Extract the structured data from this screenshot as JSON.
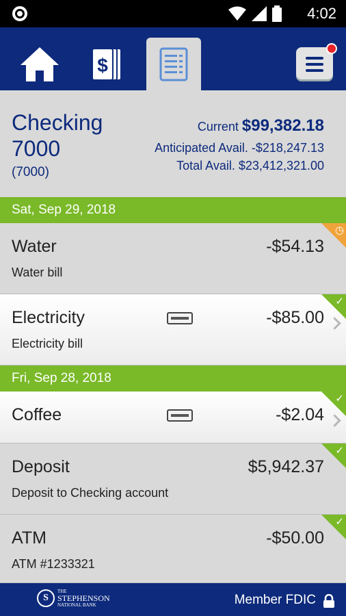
{
  "status_bar": {
    "time": "4:02"
  },
  "nav": {
    "items": [
      {
        "name": "home",
        "icon": "home-icon"
      },
      {
        "name": "payments",
        "icon": "dollar-bill-icon"
      },
      {
        "name": "transactions",
        "icon": "document-list-icon",
        "active": true
      },
      {
        "name": "menu",
        "icon": "hamburger-menu-icon",
        "has_notification": true
      }
    ]
  },
  "account": {
    "name": "Checking 7000",
    "number": "(7000)",
    "current_label": "Current",
    "current_amount": "$99,382.18",
    "anticipated_label": "Anticipated Avail.",
    "anticipated_amount": "-$218,247.13",
    "total_label": "Total Avail.",
    "total_amount": "$23,412,321.00"
  },
  "groups": [
    {
      "date": "Sat, Sep 29, 2018",
      "transactions": [
        {
          "name": "Water",
          "description": "Water bill",
          "amount": "-$54.13",
          "status": "pending",
          "card_icon": false,
          "chevron": false
        },
        {
          "name": "Electricity",
          "description": "Electricity bill",
          "amount": "-$85.00",
          "status": "cleared",
          "card_icon": true,
          "chevron": true
        }
      ]
    },
    {
      "date": "Fri, Sep 28, 2018",
      "transactions": [
        {
          "name": "Coffee",
          "description": "",
          "amount": "-$2.04",
          "status": "cleared",
          "card_icon": true,
          "chevron": true
        },
        {
          "name": "Deposit",
          "description": "Deposit to Checking account",
          "amount": "$5,942.37",
          "status": "cleared",
          "card_icon": false,
          "chevron": false
        },
        {
          "name": "ATM",
          "description": "ATM #1233321",
          "amount": "-$50.00",
          "status": "cleared",
          "card_icon": false,
          "chevron": false
        }
      ]
    }
  ],
  "footer": {
    "logo_text": "STEPHENSON",
    "member_label": "Member FDIC"
  },
  "colors": {
    "navy": "#0d2a7c",
    "green": "#7ab928",
    "orange": "#f0a33a",
    "notification_red": "#e8232a"
  }
}
